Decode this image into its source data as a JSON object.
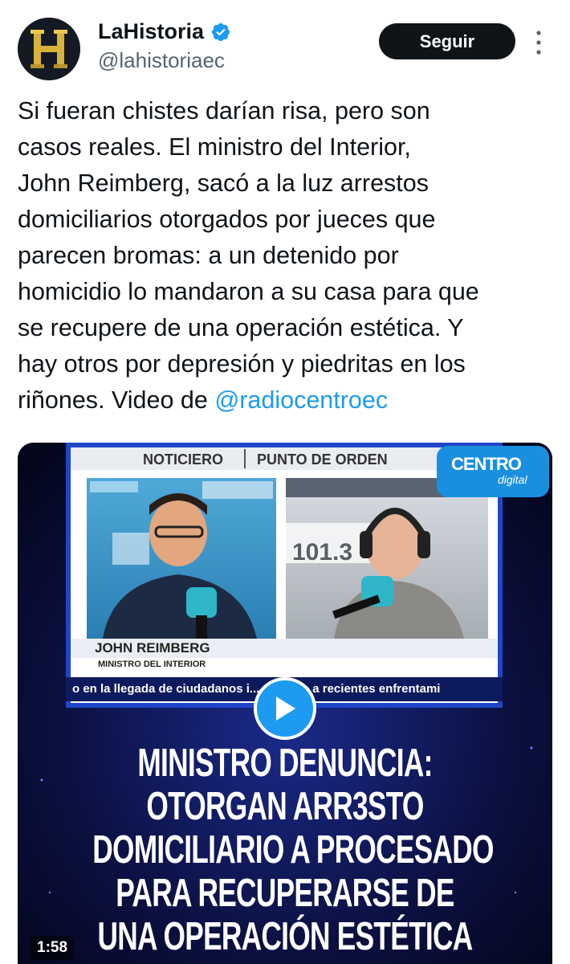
{
  "author": {
    "display_name": "LaHistoria",
    "handle": "@lahistoriaec",
    "avatar_letter": "H",
    "verified": true
  },
  "actions": {
    "follow_label": "Seguir"
  },
  "tweet": {
    "lines": [
      "Si fueran chistes darían risa, pero son",
      "casos reales. El ministro del Interior,",
      "John Reimberg, sacó a la luz arrestos",
      "domiciliarios otorgados por jueces que",
      "parecen bromas: a un detenido por",
      "homicidio lo mandaron a su casa para que",
      "se recupere de una operación estética. Y",
      "hay otros por depresión y piedritas en los"
    ],
    "last_line_prefix": "riñones. Video de ",
    "mention": "@radiocentroec"
  },
  "video": {
    "duration": "1:58",
    "tab_left": "NOTICIERO",
    "tab_right": "PUNTO DE ORDEN",
    "logo_top": "CENTRO",
    "logo_bottom": "digital",
    "frequency": "101.3",
    "lower_third_name": "JOHN REIMBERG",
    "lower_third_title": "MINISTRO DEL INTERIOR",
    "ticker": "o en la llegada de ciudadanos i... sumado a recientes enfrentami",
    "headline_lines": [
      "MINISTRO DENUNCIA:",
      "OTORGAN ARR3STO",
      "DOMICILIARIO A PROCESADO",
      "PARA RECUPERARSE DE",
      "UNA OPERACIÓN ESTÉTICA"
    ],
    "accent_color": "#1d9bf0"
  }
}
